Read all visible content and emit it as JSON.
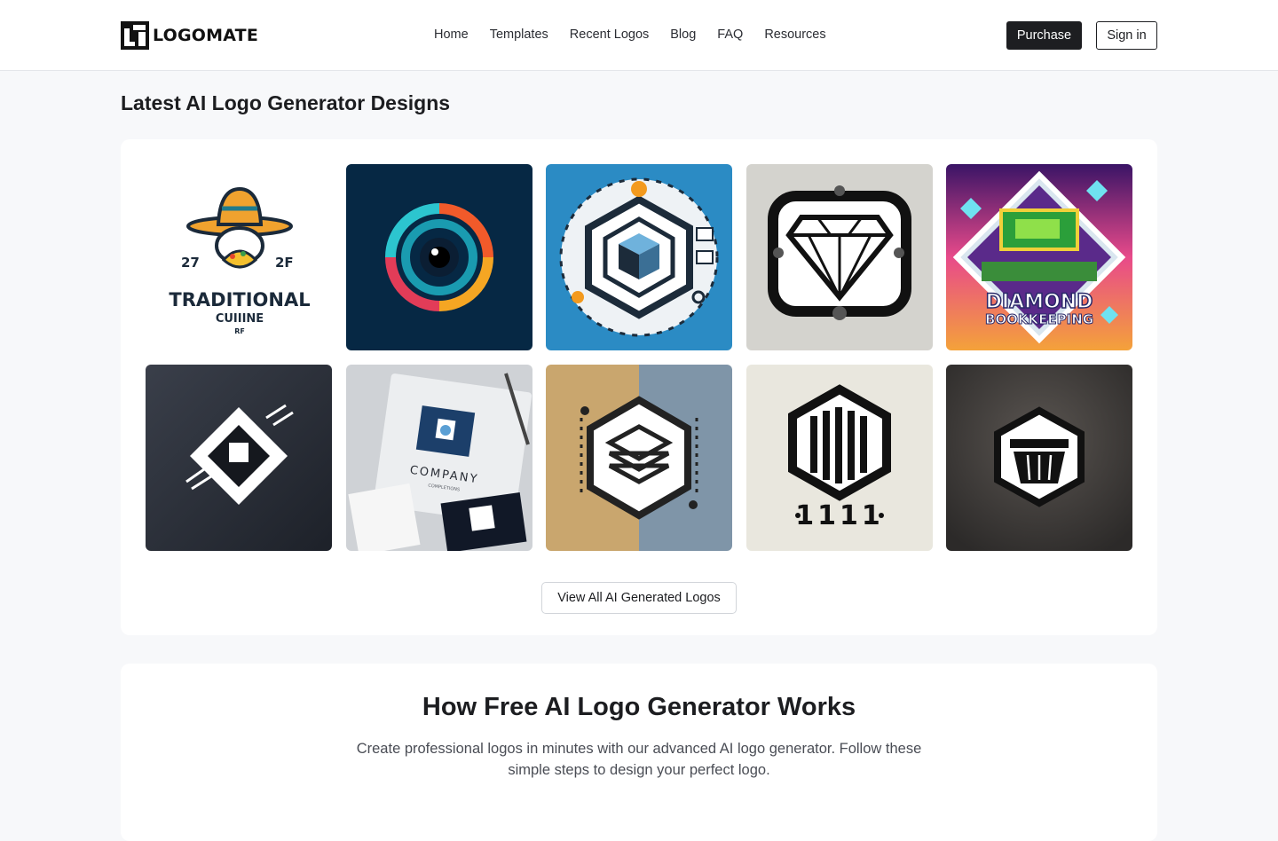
{
  "header": {
    "logo_text": "LOGOMATE",
    "nav": [
      "Home",
      "Templates",
      "Recent Logos",
      "Blog",
      "FAQ",
      "Resources"
    ],
    "purchase_label": "Purchase",
    "signin_label": "Sign in"
  },
  "gallery": {
    "title": "Latest AI Logo Generator Designs",
    "tiles": [
      {
        "name": "taco-sombrero-logo",
        "texts": [
          "27",
          "2F",
          "TRADITIONAL",
          "CUIIINE",
          "RF"
        ]
      },
      {
        "name": "abstract-eye-logo",
        "texts": []
      },
      {
        "name": "tech-cube-circuit-logo",
        "texts": []
      },
      {
        "name": "diamond-frame-logo",
        "texts": []
      },
      {
        "name": "diamond-bookkeeping-logo",
        "texts": [
          "DIAMOND",
          "BOOKKEEPING"
        ]
      },
      {
        "name": "geometric-diamond-logo",
        "texts": []
      },
      {
        "name": "company-stationery-mockup",
        "texts": [
          "COMPANY",
          "COMPLETIONS"
        ]
      },
      {
        "name": "hexagon-layers-logo",
        "texts": []
      },
      {
        "name": "hexagon-bars-1111-logo",
        "texts": [
          "1111"
        ]
      },
      {
        "name": "hexagon-basket-logo",
        "texts": []
      }
    ],
    "view_all_label": "View All AI Generated Logos"
  },
  "how": {
    "title": "How Free AI Logo Generator Works",
    "description": "Create professional logos in minutes with our advanced AI logo generator. Follow these simple steps to design your perfect logo."
  },
  "colors": {
    "accent_dark": "#1d1e21",
    "page_bg": "#f7f8fa",
    "card_bg": "#ffffff"
  }
}
